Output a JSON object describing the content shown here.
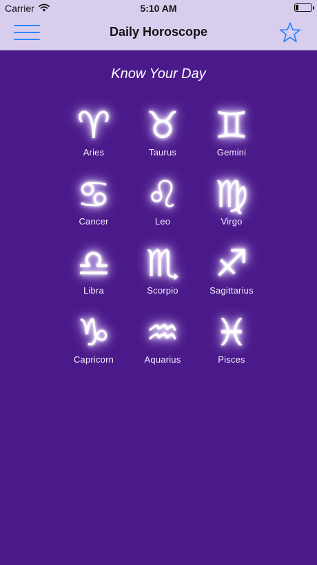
{
  "status_bar": {
    "carrier": "Carrier",
    "time": "5:10 AM",
    "battery_level": 0.18
  },
  "nav": {
    "title": "Daily Horoscope",
    "menu_icon": "hamburger-menu-icon",
    "favorite_icon": "star-outline-icon"
  },
  "main": {
    "subtitle": "Know Your Day",
    "signs": [
      {
        "name": "Aries",
        "glyph": "♈"
      },
      {
        "name": "Taurus",
        "glyph": "♉"
      },
      {
        "name": "Gemini",
        "glyph": "♊"
      },
      {
        "name": "Cancer",
        "glyph": "♋"
      },
      {
        "name": "Leo",
        "glyph": "♌"
      },
      {
        "name": "Virgo",
        "glyph": "♍"
      },
      {
        "name": "Libra",
        "glyph": "♎"
      },
      {
        "name": "Scorpio",
        "glyph": "♏"
      },
      {
        "name": "Sagittarius",
        "glyph": "♐"
      },
      {
        "name": "Capricorn",
        "glyph": "♑"
      },
      {
        "name": "Aquarius",
        "glyph": "♒"
      },
      {
        "name": "Pisces",
        "glyph": "♓"
      }
    ]
  },
  "colors": {
    "background": "#4a1a8a",
    "header": "#d9cdee",
    "accent": "#2f86ff"
  }
}
